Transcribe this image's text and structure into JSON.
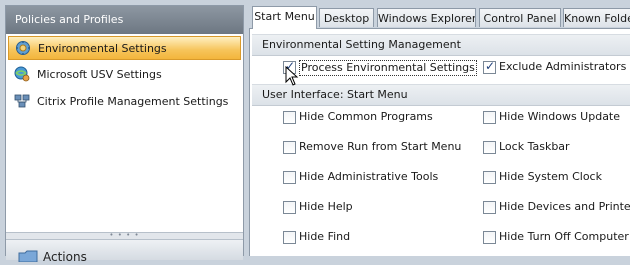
{
  "sidebar": {
    "header": "Policies and Profiles",
    "items": [
      {
        "label": "Environmental Settings",
        "icon": "gear-globe-icon",
        "active": true
      },
      {
        "label": "Microsoft USV Settings",
        "icon": "globe-users-icon",
        "active": false
      },
      {
        "label": "Citrix Profile Management Settings",
        "icon": "network-computers-icon",
        "active": false
      }
    ],
    "actions_label": "Actions"
  },
  "tabs": [
    "Start Menu",
    "Desktop",
    "Windows Explorer",
    "Control Panel",
    "Known Folde"
  ],
  "active_tab": "Start Menu",
  "main": {
    "section1": {
      "title": "Environmental Setting Management",
      "process_label": "Process Environmental Settings",
      "process_checked": true,
      "exclude_label": "Exclude Administrators",
      "exclude_checked": true
    },
    "section2": {
      "title": "User Interface: Start Menu",
      "left_options": [
        "Hide Common Programs",
        "Remove Run from Start Menu",
        "Hide Administrative Tools",
        "Hide Help",
        "Hide Find"
      ],
      "right_options": [
        "Hide Windows Update",
        "Lock Taskbar",
        "Hide System Clock",
        "Hide Devices and Printers",
        "Hide Turn Off Computer"
      ]
    }
  },
  "colors": {
    "active_item": "#f6c45a",
    "header_gray": "#7b858f",
    "check_blue": "#1f3f7a"
  }
}
